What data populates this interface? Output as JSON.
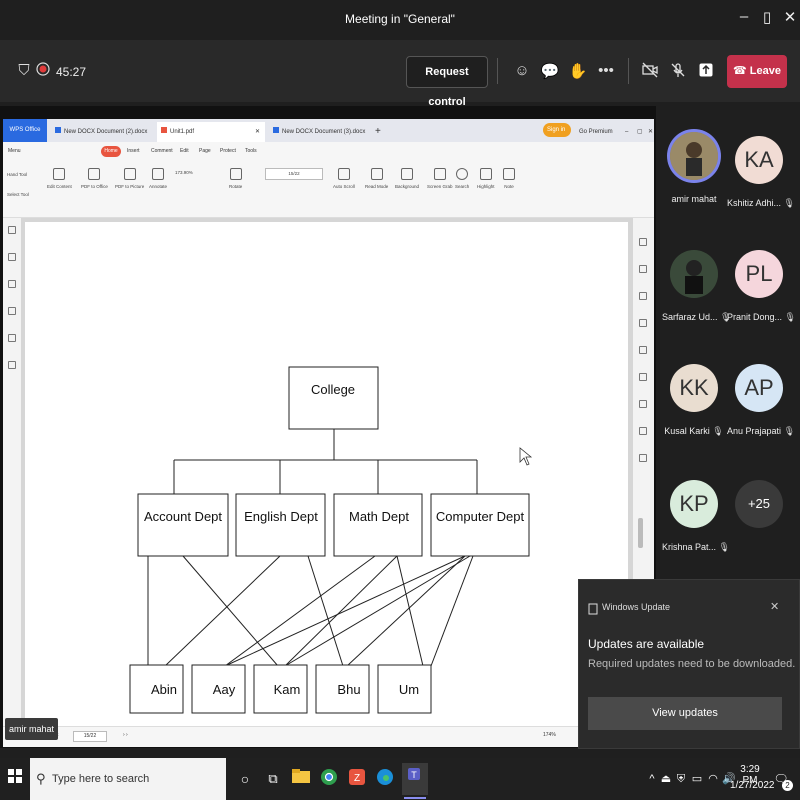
{
  "window": {
    "title": "Meeting in \"General\""
  },
  "meeting": {
    "timer": "45:27",
    "request_control": "Request control",
    "leave": "Leave"
  },
  "wps": {
    "office_tab": "WPS Office",
    "tabs": [
      "New DOCX Document (2).docx",
      "Unit1.pdf",
      "New DOCX Document (3).docx"
    ],
    "sign_in": "Sign in",
    "premium": "Go Premium",
    "menu": [
      "Menu",
      "Home",
      "Insert",
      "Comment",
      "Edit",
      "Page",
      "Protect",
      "Tools"
    ],
    "tools": [
      "Hand Tool",
      "Select Tool",
      "Edit Content",
      "PDF to Office",
      "PDF to Picture",
      "Annotate",
      "Rotate",
      "Auto Scroll",
      "Read Mode",
      "Background",
      "Screen Grab",
      "Search",
      "Highlight",
      "Note"
    ],
    "zoom": "173.90%",
    "page": "15/22",
    "status_page": "15/22",
    "status_zoom": "174%"
  },
  "diagram": {
    "root": "College",
    "depts": [
      "Account Dept",
      "English Dept",
      "Math Dept",
      "Computer Dept"
    ],
    "people": [
      "Abin",
      "Aay",
      "Kam",
      "Bhu",
      "Um"
    ]
  },
  "presenter": "amir mahat",
  "participants": [
    {
      "initials": "",
      "name": "amir mahat",
      "color": "#8a7a60"
    },
    {
      "initials": "KA",
      "name": "Kshitiz Adhi...",
      "color": "#f1dcd4"
    },
    {
      "initials": "",
      "name": "Sarfaraz Ud...",
      "color": "#2a3a2a"
    },
    {
      "initials": "PL",
      "name": "Pranit Dong...",
      "color": "#f5d6dc"
    },
    {
      "initials": "KK",
      "name": "Kusal Karki",
      "color": "#e9ddd0"
    },
    {
      "initials": "AP",
      "name": "Anu Prajapati",
      "color": "#d6e6f5"
    },
    {
      "initials": "KP",
      "name": "Krishna Pat...",
      "color": "#d9ecdc"
    },
    {
      "initials": "+25",
      "name": "",
      "color": "#3a3a3a"
    }
  ],
  "notification": {
    "app": "Windows Update",
    "title": "Updates are available",
    "body": "Required updates need to be downloaded.",
    "action": "View updates"
  },
  "taskbar": {
    "search_placeholder": "Type here to search",
    "time": "3:29 PM",
    "date": "1/27/2022",
    "notif_count": "2"
  }
}
